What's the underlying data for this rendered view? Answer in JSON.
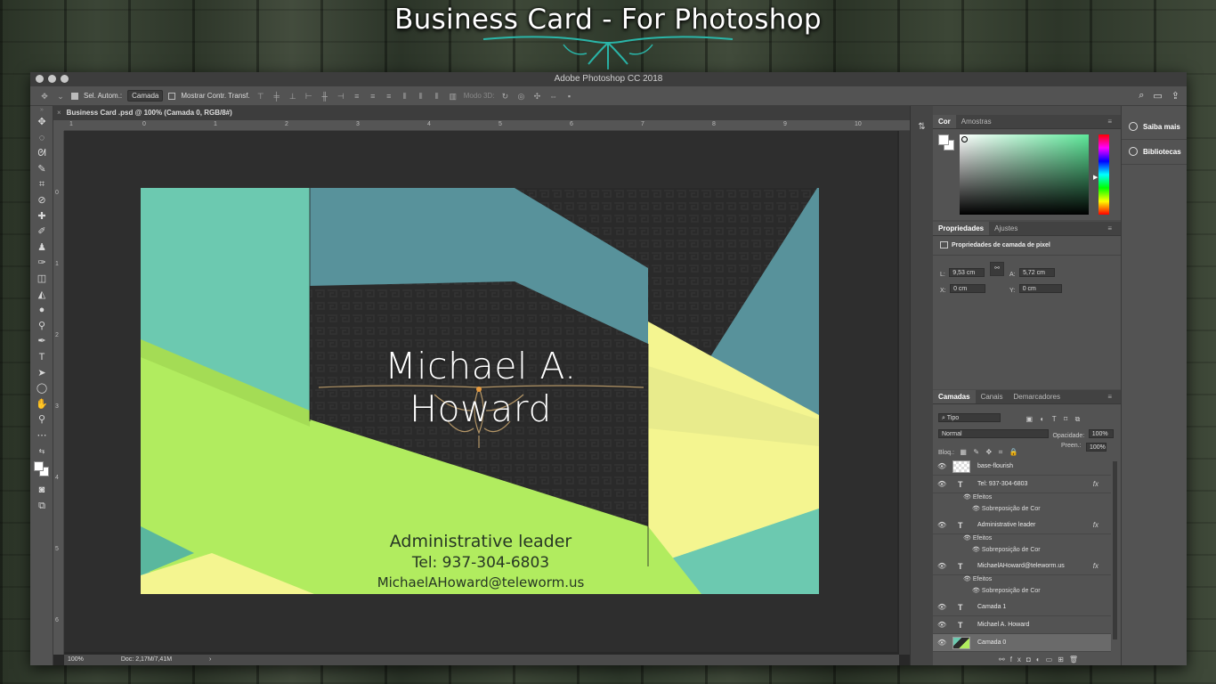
{
  "promo": {
    "title": "Business Card - For Photoshop"
  },
  "window": {
    "title": "Adobe Photoshop CC 2018"
  },
  "options_bar": {
    "auto_select_label": "Sel. Autom.:",
    "auto_select_value": "Camada",
    "show_transform_label": "Mostrar Contr. Transf.",
    "mode3d_label": "Modo 3D:"
  },
  "document": {
    "tab_title": "Business Card .psd @ 100% (Camada 0, RGB/8#)",
    "zoom": "100%",
    "doc_info": "Doc: 2,17M/7,41M",
    "ruler_h": [
      "1",
      "0",
      "1",
      "2",
      "3",
      "4",
      "5",
      "6",
      "7",
      "8",
      "9",
      "10"
    ],
    "ruler_v": [
      "0",
      "1",
      "2",
      "3",
      "4",
      "5",
      "6"
    ]
  },
  "card": {
    "name": "Michael A. Howard",
    "role": "Administrative leader",
    "tel": "Tel: 937-304-6803",
    "email": "MichaelAHoward@teleworm.us",
    "colors": {
      "teal": "#6cc9b0",
      "steel": "#58929b",
      "dark": "#2a2a2a",
      "lime": "#b1ec5f",
      "yellow": "#f4f590"
    }
  },
  "color_panel": {
    "tabs": [
      "Cor",
      "Amostras"
    ]
  },
  "properties_panel": {
    "tabs": [
      "Propriedades",
      "Ajustes"
    ],
    "header": "Propriedades de camada de pixel",
    "w_label": "L:",
    "w_value": "9,53 cm",
    "h_label": "A:",
    "h_value": "5,72 cm",
    "x_label": "X:",
    "x_value": "0 cm",
    "y_label": "Y:",
    "y_value": "0 cm"
  },
  "layers_panel": {
    "tabs": [
      "Camadas",
      "Canais",
      "Demarcadores"
    ],
    "filter": "Tipo",
    "blend_mode": "Normal",
    "opacity_label": "Opacidade:",
    "opacity_value": "100%",
    "lock_label": "Bloq.:",
    "fill_label": "Preen.:",
    "fill_value": "100%",
    "layers": [
      {
        "name": "base-flourish",
        "type": "smart"
      },
      {
        "name": "Tel: 937-304-6803",
        "type": "text",
        "fx": "fx",
        "effects": "Efeitos",
        "effect": "Sobreposição de Cor"
      },
      {
        "name": "Administrative leader",
        "type": "text",
        "fx": "fx",
        "effects": "Efeitos",
        "effect": "Sobreposição de Cor"
      },
      {
        "name": "MichaelAHoward@teleworm.us",
        "type": "text",
        "fx": "fx",
        "effects": "Efeitos",
        "effect": "Sobreposição de Cor"
      },
      {
        "name": "Camada 1",
        "type": "text"
      },
      {
        "name": "Michael A. Howard",
        "type": "text"
      },
      {
        "name": "Camada 0",
        "type": "pixel"
      }
    ]
  },
  "right_column": {
    "learn": "Saiba mais",
    "libraries": "Bibliotecas"
  }
}
